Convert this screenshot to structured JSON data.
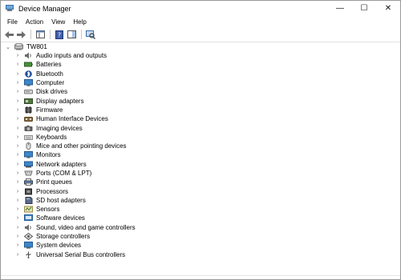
{
  "window": {
    "title": "Device Manager",
    "minimize_glyph": "—",
    "maximize_glyph": "☐",
    "close_glyph": "✕"
  },
  "menu": [
    "File",
    "Action",
    "View",
    "Help"
  ],
  "toolbar": {
    "buttons": [
      "back-arrow-icon",
      "forward-arrow-icon",
      "properties-pane-icon",
      "help-book-icon",
      "view-icon",
      "scan-hardware-icon"
    ]
  },
  "tree": {
    "root": {
      "label": "TW801",
      "chevron": "⌄",
      "icon": "computer-icon"
    },
    "items": [
      {
        "label": "Audio inputs and outputs",
        "icon": "speaker-icon",
        "color": "#6a6a6a"
      },
      {
        "label": "Batteries",
        "icon": "battery-icon",
        "color": "#4a8f3c"
      },
      {
        "label": "Bluetooth",
        "icon": "bluetooth-icon",
        "color": "#1f4e9c"
      },
      {
        "label": "Computer",
        "icon": "monitor-icon",
        "color": "#3c86cc"
      },
      {
        "label": "Disk drives",
        "icon": "disk-drive-icon",
        "color": "#7d7d7d"
      },
      {
        "label": "Display adapters",
        "icon": "display-adapter-icon",
        "color": "#4f7a3d"
      },
      {
        "label": "Firmware",
        "icon": "firmware-icon",
        "color": "#6b6b6b"
      },
      {
        "label": "Human Interface Devices",
        "icon": "hid-icon",
        "color": "#8a6c3e"
      },
      {
        "label": "Imaging devices",
        "icon": "camera-icon",
        "color": "#5a5a5a"
      },
      {
        "label": "Keyboards",
        "icon": "keyboard-icon",
        "color": "#8c8c8c"
      },
      {
        "label": "Mice and other pointing devices",
        "icon": "mouse-icon",
        "color": "#707070"
      },
      {
        "label": "Monitors",
        "icon": "monitor-icon",
        "color": "#3c86cc"
      },
      {
        "label": "Network adapters",
        "icon": "network-adapter-icon",
        "color": "#3c86cc"
      },
      {
        "label": "Ports (COM & LPT)",
        "icon": "port-icon",
        "color": "#6a6a6a"
      },
      {
        "label": "Print queues",
        "icon": "printer-icon",
        "color": "#5b7fb0"
      },
      {
        "label": "Processors",
        "icon": "processor-icon",
        "color": "#4a4a4a"
      },
      {
        "label": "SD host adapters",
        "icon": "sd-card-icon",
        "color": "#5a6e8c"
      },
      {
        "label": "Sensors",
        "icon": "sensor-icon",
        "color": "#9a8a40"
      },
      {
        "label": "Software devices",
        "icon": "software-device-icon",
        "color": "#3c86cc"
      },
      {
        "label": "Sound, video and game controllers",
        "icon": "speaker-icon",
        "color": "#6a6a6a"
      },
      {
        "label": "Storage controllers",
        "icon": "storage-controller-icon",
        "color": "#5a5a5a"
      },
      {
        "label": "System devices",
        "icon": "system-device-icon",
        "color": "#3c86cc"
      },
      {
        "label": "Universal Serial Bus controllers",
        "icon": "usb-icon",
        "color": "#555555"
      }
    ],
    "collapsed_chevron": "›"
  }
}
